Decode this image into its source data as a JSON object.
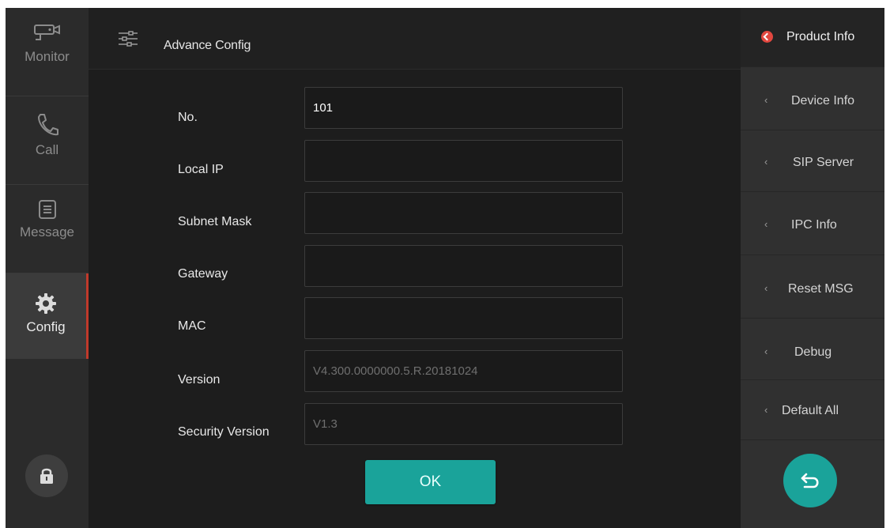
{
  "header": {
    "title": "Advance Config"
  },
  "nav": {
    "items": [
      {
        "key": "monitor",
        "label": "Monitor"
      },
      {
        "key": "call",
        "label": "Call"
      },
      {
        "key": "message",
        "label": "Message"
      },
      {
        "key": "config",
        "label": "Config"
      }
    ],
    "active": "Config",
    "active_color": "#c0392b"
  },
  "form": {
    "rows": [
      {
        "label": "No.",
        "value": "101"
      },
      {
        "label": "Local IP",
        "value": ""
      },
      {
        "label": "Subnet Mask",
        "value": ""
      },
      {
        "label": "Gateway",
        "value": ""
      },
      {
        "label": "MAC",
        "value": ""
      },
      {
        "label": "Version",
        "value": "V4.300.0000000.5.R.20181024"
      },
      {
        "label": "Security Version",
        "value": "V1.3"
      }
    ],
    "ok_label": "OK"
  },
  "sidebar": {
    "items": [
      {
        "label": "Product Info",
        "active": true
      },
      {
        "label": "Device Info"
      },
      {
        "label": "SIP Server"
      },
      {
        "label": "IPC Info"
      },
      {
        "label": "Reset MSG"
      },
      {
        "label": "Debug"
      },
      {
        "label": "Default All"
      }
    ],
    "chevron": "‹"
  },
  "icons": {
    "monitor": "camera-icon",
    "call": "phone-icon",
    "message": "message-icon",
    "config": "gear-icon",
    "lock": "lock-icon",
    "header": "sliders-icon",
    "back": "back-arrow-icon",
    "active_item": "check-dot-icon"
  },
  "colors": {
    "accent": "#1aa39a",
    "active_dot": "#e2473f",
    "background": "#1d1d1d"
  }
}
